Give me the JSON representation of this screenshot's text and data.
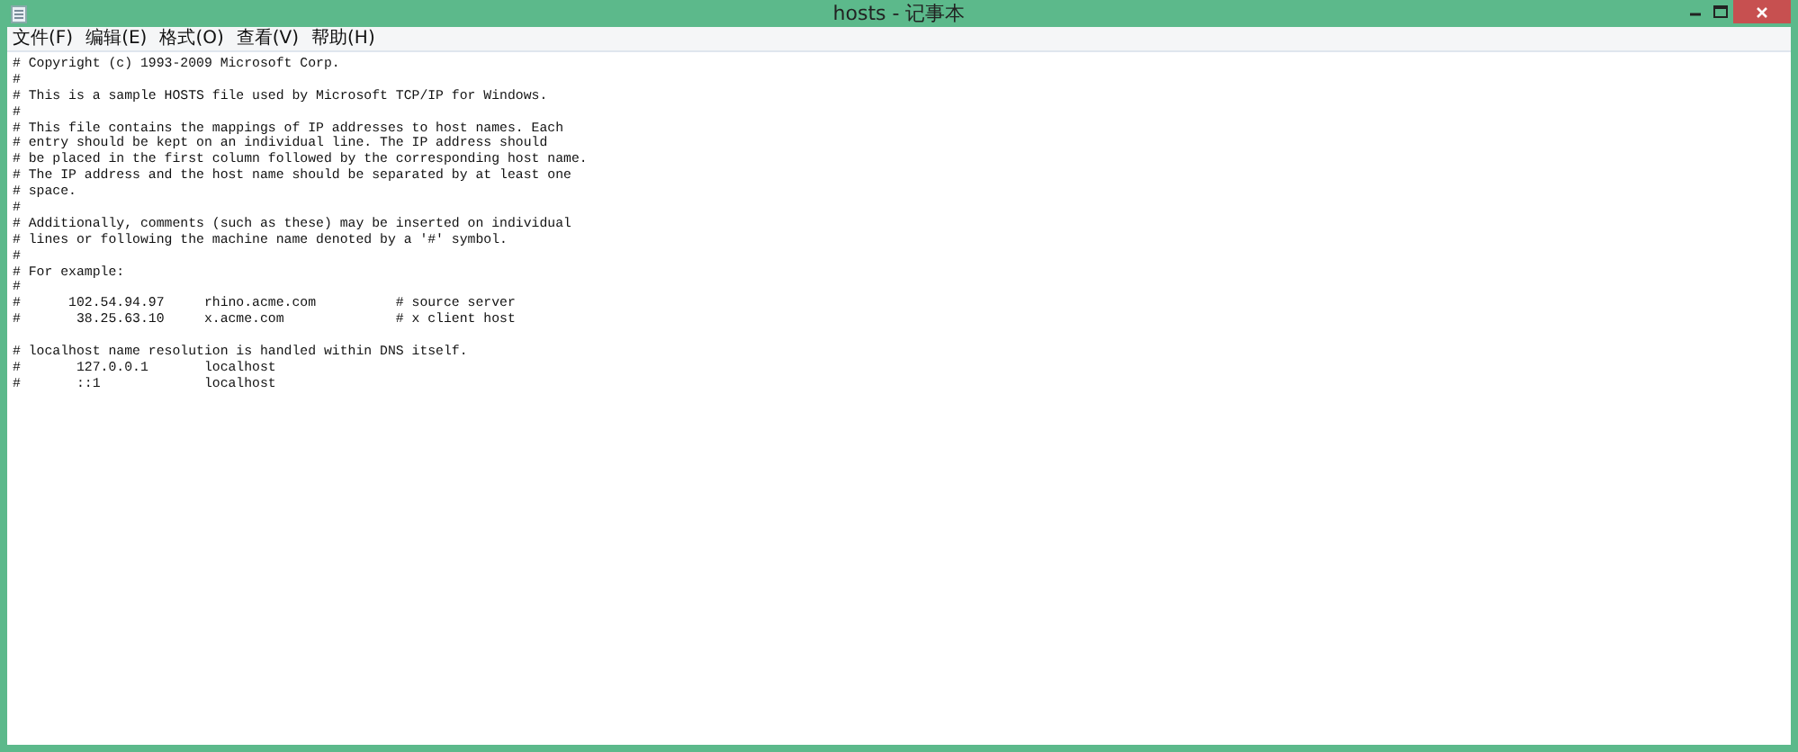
{
  "window": {
    "title": "hosts - 记事本"
  },
  "menu": [
    "文件(F)",
    "编辑(E)",
    "格式(O)",
    "查看(V)",
    "帮助(H)"
  ],
  "editor": {
    "blocks": [
      [
        "# Copyright (c) 1993-2009 Microsoft Corp.",
        "#",
        "# This is a sample HOSTS file used by Microsoft TCP/IP for Windows.",
        "#",
        "# This file contains the mappings of IP addresses to host names. Each",
        "# entry should be kept on an individual line. The IP address should",
        "# be placed in the first column followed by the corresponding host name.",
        "# The IP address and the host name should be separated by at least one",
        "# space.",
        "#",
        "# Additionally, comments (such as these) may be inserted on individual",
        "# lines or following the machine name denoted by a '#' symbol.",
        "#",
        "# For example:",
        "#",
        "#      102.54.94.97     rhino.acme.com          # source server",
        "#       38.25.63.10     x.acme.com              # x client host"
      ],
      [
        "# localhost name resolution is handled within DNS itself.",
        "#       127.0.0.1       localhost",
        "#       ::1             localhost"
      ]
    ]
  }
}
